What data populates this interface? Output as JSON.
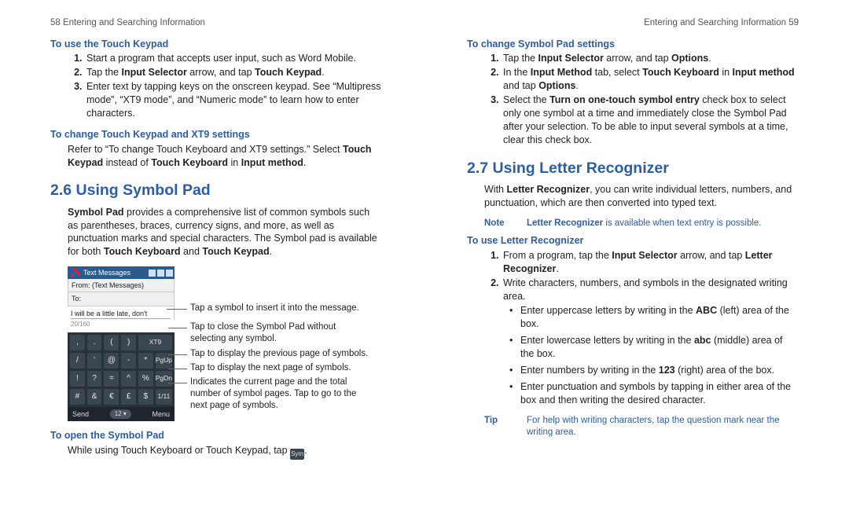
{
  "left": {
    "header": "58  Entering and Searching Information",
    "h1": "To use the Touch Keypad",
    "s1_1": "Start a program that accepts user input, such as Word Mobile.",
    "s1_2a": "Tap the ",
    "s1_2b": "Input Selector",
    "s1_2c": " arrow, and tap ",
    "s1_2d": "Touch Keypad",
    "s1_2e": ".",
    "s1_3": "Enter text by tapping keys on the onscreen keypad. See “Multipress mode”, “XT9 mode”, and “Numeric mode” to learn how to enter characters.",
    "h2": "To change Touch Keypad and XT9 settings",
    "p2a": "Refer to “To change Touch Keyboard and XT9 settings.” Select ",
    "p2b": "Touch Keypad",
    "p2c": " instead of ",
    "p2d": "Touch Keyboard",
    "p2e": " in ",
    "p2f": "Input method",
    "p2g": ".",
    "sec": "2.6  Using Symbol Pad",
    "sp1a": "Symbol Pad",
    "sp1b": " provides a comprehensive list of common symbols such as parentheses, braces, currency signs, and more, as well as punctuation marks and special characters. The Symbol pad is available for both ",
    "sp1c": "Touch Keyboard",
    "sp1d": " and ",
    "sp1e": "Touch Keypad",
    "sp1f": ".",
    "co_label": "Tap a symbol to insert it into the message.",
    "co_close": "Tap to close the Symbol Pad without selecting any symbol.",
    "co_prev": "Tap to display the previous page of symbols.",
    "co_next": "Tap to display the next page of symbols.",
    "co_ind": "Indicates the current page and the total number of symbol pages. Tap to go to the next page of symbols.",
    "h3": "To open the Symbol Pad",
    "open_a": "While using Touch Keyboard or Touch Keypad, tap ",
    "open_b": "Sym",
    "open_c": ".",
    "phone": {
      "title": "Text Messages",
      "from": "From:",
      "from_v": "(Text Messages)",
      "to": "To:",
      "typed": "I will be a little late, don't",
      "count": "20/160",
      "grid": [
        ",",
        ".",
        "(",
        ")",
        "XT9",
        "/",
        "'",
        "@",
        "-",
        "*",
        "PgUp",
        "!",
        "?",
        "=",
        "^",
        "%",
        "PgDn",
        "#",
        "&",
        "€",
        "£",
        "$",
        "1/11"
      ],
      "send": "Send",
      "mid": "12 ▾",
      "menu": "Menu"
    }
  },
  "right": {
    "header": "Entering and Searching Information  59",
    "h1": "To change Symbol Pad settings",
    "s1_1a": "Tap the ",
    "s1_1b": "Input Selector",
    "s1_1c": " arrow, and tap ",
    "s1_1d": "Options",
    "s1_1e": ".",
    "s1_2a": "In the ",
    "s1_2b": "Input Method",
    "s1_2c": " tab, select ",
    "s1_2d": "Touch Keyboard",
    "s1_2e": " in ",
    "s1_2f": "Input method",
    "s1_2g": " and tap ",
    "s1_2h": "Options",
    "s1_2i": ".",
    "s1_3a": "Select the ",
    "s1_3b": "Turn on one-touch symbol entry",
    "s1_3c": " check box to select only one symbol at a time and immediately close the Symbol Pad after your selection. To be able to input several symbols at a time, clear this check box.",
    "sec": "2.7  Using Letter Recognizer",
    "p1a": "With ",
    "p1b": "Letter Recognizer",
    "p1c": ", you can write individual letters, numbers, and punctuation, which are then converted into typed text.",
    "note_lab": "Note",
    "note_txt_a": "Letter Recognizer",
    "note_txt_b": " is available when text entry is possible.",
    "h2": "To use Letter Recognizer",
    "s2_1a": "From a program, tap the ",
    "s2_1b": "Input Selector",
    "s2_1c": " arrow, and tap ",
    "s2_1d": "Letter Recognizer",
    "s2_1e": ".",
    "s2_2": "Write characters, numbers, and symbols in the designated writing area.",
    "b1a": "Enter uppercase letters by writing in the ",
    "b1b": "ABC",
    "b1c": " (left) area of the box.",
    "b2a": "Enter lowercase letters by writing in the ",
    "b2b": "abc",
    "b2c": " (middle) area of the box.",
    "b3a": "Enter numbers by writing in the ",
    "b3b": "123",
    "b3c": " (right) area of the box.",
    "b4": "Enter punctuation and symbols by tapping in either area of the box and then writing the desired character.",
    "tip_lab": "Tip",
    "tip_txt": "For help with writing characters, tap the question mark near the writing area."
  }
}
